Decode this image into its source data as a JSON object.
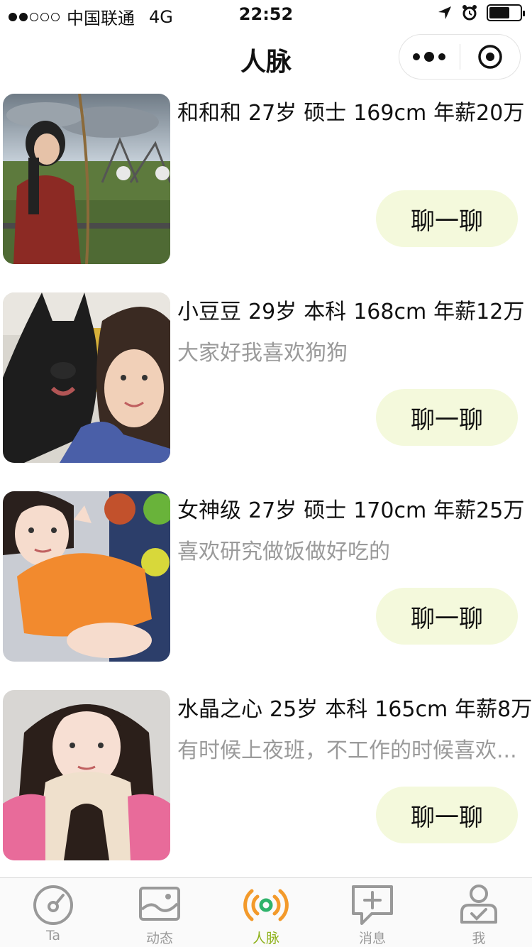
{
  "status_bar": {
    "carrier": "中国联通",
    "network": "4G",
    "time": "22:52"
  },
  "nav": {
    "title": "人脉"
  },
  "profiles": [
    {
      "name": "和和和",
      "age": "27岁",
      "education": "硕士",
      "height": "169cm",
      "salary": "年薪20万",
      "bio": "",
      "chat_label": "聊一聊"
    },
    {
      "name": "小豆豆",
      "age": "29岁",
      "education": "本科",
      "height": "168cm",
      "salary": "年薪12万",
      "bio": "大家好我喜欢狗狗",
      "chat_label": "聊一聊"
    },
    {
      "name": "女神级",
      "age": "27岁",
      "education": "硕士",
      "height": "170cm",
      "salary": "年薪25万",
      "bio": "喜欢研究做饭做好吃的",
      "chat_label": "聊一聊"
    },
    {
      "name": "水晶之心",
      "age": "25岁",
      "education": "本科",
      "height": "165cm",
      "salary": "年薪8万",
      "bio": "有时候上夜班，不工作的时候喜欢...",
      "chat_label": "聊一聊"
    }
  ],
  "tabs": [
    {
      "label": "Ta",
      "icon": "gauge-icon"
    },
    {
      "label": "动态",
      "icon": "image-icon"
    },
    {
      "label": "人脉",
      "icon": "radar-icon",
      "active": true
    },
    {
      "label": "消息",
      "icon": "message-add-icon"
    },
    {
      "label": "我",
      "icon": "user-icon"
    }
  ],
  "colors": {
    "chat_button_bg": "#f4f9dc",
    "active_tab": "#8fb21c",
    "inactive_tab": "#999999",
    "radar_orange": "#f39a2b",
    "radar_green": "#2fb36b"
  }
}
